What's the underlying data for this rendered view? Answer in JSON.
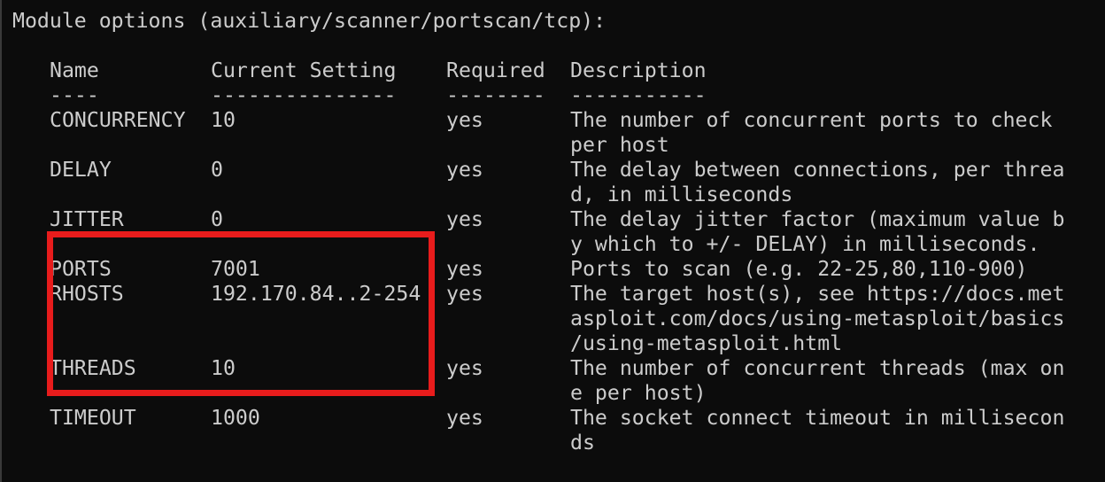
{
  "header": "Module options (auxiliary/scanner/portscan/tcp):",
  "columns": {
    "name": "Name",
    "setting": "Current Setting",
    "required": "Required",
    "description": "Description"
  },
  "underlines": {
    "name": "----",
    "setting": "---------------",
    "required": "--------",
    "description": "-----------"
  },
  "rows": [
    {
      "name": "CONCURRENCY",
      "setting": "10",
      "required": "yes",
      "desc": [
        "The number of concurrent ports to check",
        "per host"
      ]
    },
    {
      "name": "DELAY",
      "setting": "0",
      "required": "yes",
      "desc": [
        "The delay between connections, per threa",
        "d, in milliseconds"
      ]
    },
    {
      "name": "JITTER",
      "setting": "0",
      "required": "yes",
      "desc": [
        "The delay jitter factor (maximum value b",
        "y which to +/- DELAY) in milliseconds."
      ]
    },
    {
      "name": "PORTS",
      "setting": "7001",
      "required": "yes",
      "desc": [
        "Ports to scan (e.g. 22-25,80,110-900)"
      ]
    },
    {
      "name": "RHOSTS",
      "setting": "192.170.84..2-254",
      "required": "yes",
      "desc": [
        "The target host(s), see https://docs.met",
        "asploit.com/docs/using-metasploit/basics",
        "/using-metasploit.html"
      ]
    },
    {
      "name": "THREADS",
      "setting": "10",
      "required": "yes",
      "desc": [
        "The number of concurrent threads (max on",
        "e per host)"
      ]
    },
    {
      "name": "TIMEOUT",
      "setting": "1000",
      "required": "yes",
      "desc": [
        "The socket connect timeout in millisecon",
        "ds"
      ]
    }
  ],
  "colors": {
    "background": "#0c0c0c",
    "text": "#cccccc",
    "highlight": "#e81c1c"
  }
}
